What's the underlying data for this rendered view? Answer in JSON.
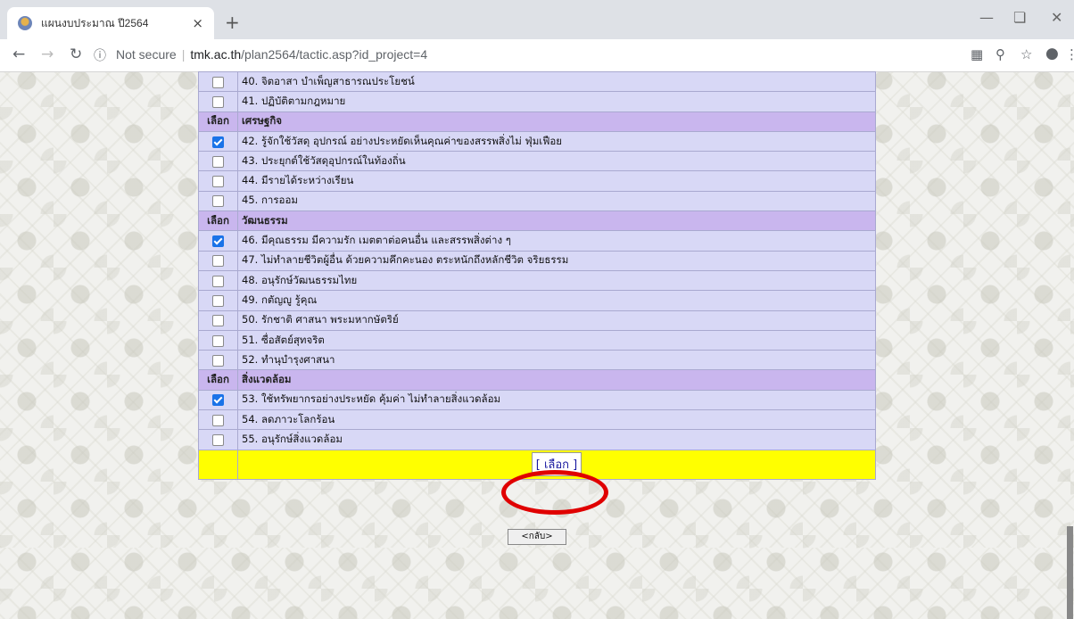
{
  "browser": {
    "tab_title": "แผนงบประมาณ ปี2564",
    "tab_close": "×",
    "new_tab": "+",
    "not_secure": "Not secure",
    "url_host": "tmk.ac.th",
    "url_path": "/plan2564/tactic.asp?id_project=4"
  },
  "table": {
    "select_label": "เลือก",
    "rows": [
      {
        "type": "item",
        "checked": false,
        "text": "40. จิตอาสา บำเพ็ญสาธารณประโยชน์"
      },
      {
        "type": "item",
        "checked": false,
        "text": "41. ปฏิบัติตามกฎหมาย"
      },
      {
        "type": "header",
        "text": "เศรษฐกิจ"
      },
      {
        "type": "item",
        "checked": true,
        "text": "42. รู้จักใช้วัสดุ อุปกรณ์ อย่างประหยัดเห็นคุณค่าของสรรพสิ่งไม่ ฟุ่มเฟือย"
      },
      {
        "type": "item",
        "checked": false,
        "text": "43. ประยุกต์ใช้วัสดุอุปกรณ์ในท้องถิ่น"
      },
      {
        "type": "item",
        "checked": false,
        "text": "44. มีรายได้ระหว่างเรียน"
      },
      {
        "type": "item",
        "checked": false,
        "text": "45. การออม"
      },
      {
        "type": "header",
        "text": "วัฒนธรรม"
      },
      {
        "type": "item",
        "checked": true,
        "text": "46. มีคุณธรรม มีความรัก เมตตาต่อคนอื่น และสรรพสิ่งต่าง ๆ"
      },
      {
        "type": "item",
        "checked": false,
        "text": "47. ไม่ทำลายชีวิตผู้อื่น ด้วยความคึกคะนอง ตระหนักถึงหลักชีวิต จริยธรรม"
      },
      {
        "type": "item",
        "checked": false,
        "text": "48. อนุรักษ์วัฒนธรรมไทย"
      },
      {
        "type": "item",
        "checked": false,
        "text": "49. กตัญญู รู้คุณ"
      },
      {
        "type": "item",
        "checked": false,
        "text": "50. รักชาติ ศาสนา พระมหากษัตริย์"
      },
      {
        "type": "item",
        "checked": false,
        "text": "51. ซื่อสัตย์สุทจริต"
      },
      {
        "type": "item",
        "checked": false,
        "text": "52. ทำนุบำรุงศาสนา"
      },
      {
        "type": "header",
        "text": "สิ่งแวดล้อม"
      },
      {
        "type": "item",
        "checked": true,
        "text": "53. ใช้ทรัพยากรอย่างประหยัด คุ้มค่า ไม่ทำลายสิ่งแวดล้อม"
      },
      {
        "type": "item",
        "checked": false,
        "text": "54. ลดภาวะโลกร้อน"
      },
      {
        "type": "item",
        "checked": false,
        "text": "55. อนุรักษ์สิ่งแวดล้อม"
      }
    ],
    "submit_button": "[ เลือก ]",
    "back_button": "<กลับ>"
  }
}
